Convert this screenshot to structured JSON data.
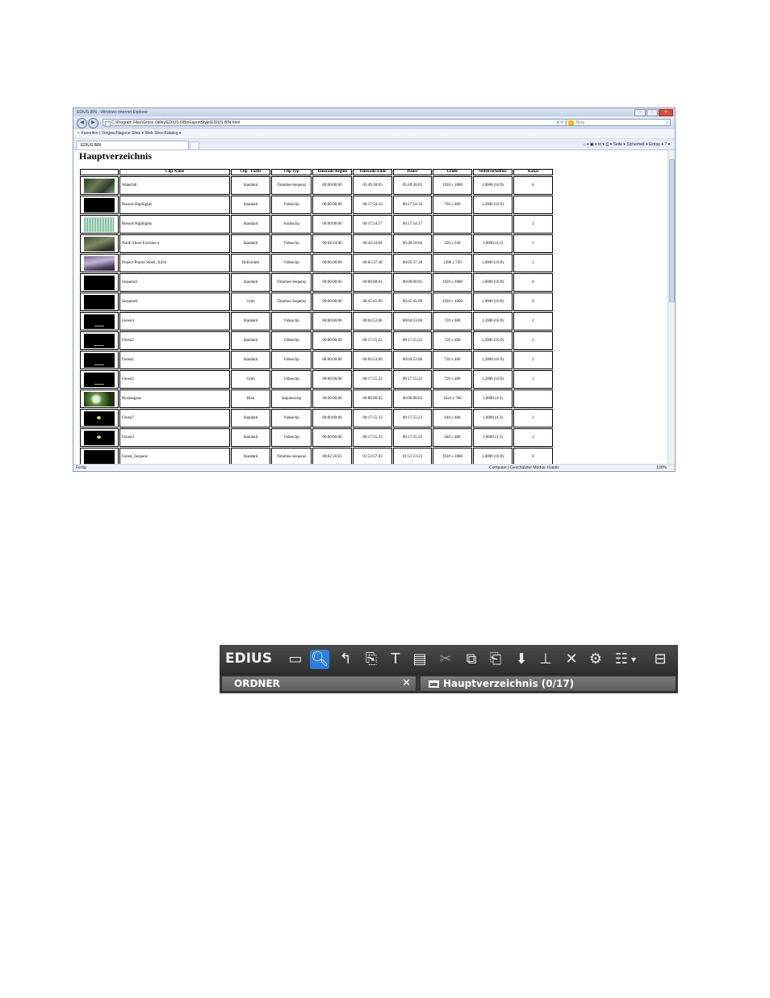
{
  "browser": {
    "window_title": "EDIUS BIN - Windows Internet Explorer",
    "address": "C:\\Program Files\\Grass Valley\\EDIUS 6\\BinExportStyle\\EDIUS BIN.html",
    "search_placeholder": "Bing",
    "favorites_bar": "Favoriten   |   Vorgeschlagene Sites ▾   Web Slice-Katalog ▾",
    "tab_label": "EDIUS BIN",
    "command_bar": "Seite ▾   Sicherheit ▾   Extras ▾",
    "status_left": "Fertig",
    "status_mid": "Computer | Geschützter Modus: Inaktiv",
    "status_zoom": "100%"
  },
  "page": {
    "heading": "Hauptverzeichnis",
    "columns": [
      "",
      "Clip-Name",
      "Clip - Farbe",
      "Clip-Typ",
      "Timecode-Beginn",
      "Timecode-Ende",
      "Dauer",
      "Größe",
      "Seitenverhältnis",
      "Kanal"
    ],
    "rows": [
      {
        "name": "Waterfall",
        "color": "Standard",
        "type": "Timeline-Sequenz",
        "tc_in": "00:00:00:00",
        "tc_out": "05:49:30:05",
        "duration": "05:49:30:05",
        "size": "1920 x 1080",
        "aspect": "1,0000 (16:9)",
        "channel": "8",
        "thumb": "t-waterfall"
      },
      {
        "name": "Rresort Highlights",
        "color": "Standard",
        "type": "Videoclip",
        "tc_in": "00:00:00:00",
        "tc_out": "00:17:54:16",
        "duration": "00:17:54:16",
        "size": "720 x 480",
        "aspect": "1,2000 (16:9)",
        "channel": "",
        "thumb": "t-black"
      },
      {
        "name": "Rresort Highlights",
        "color": "Standard",
        "type": "Audioclip",
        "tc_in": "00:00:00:00",
        "tc_out": "00:17:54:17",
        "duration": "00:17:54:17",
        "size": "",
        "aspect": "",
        "channel": "2",
        "thumb": "t-audio"
      },
      {
        "name": "North Shore Extreme 4",
        "color": "Standard",
        "type": "Videoclip",
        "tc_in": "00:04:24:00",
        "tc_out": "00:44:34:04",
        "duration": "00:40:10:04",
        "size": "320 x 240",
        "aspect": "1,0000 (4:3)",
        "channel": "1",
        "thumb": "t-north"
      },
      {
        "name": "Project Prairie Street_X264",
        "color": "Hellviolett",
        "type": "Videoclip",
        "tc_in": "00:00:00:00",
        "tc_out": "00:05:37:38",
        "duration": "00:05:37:38",
        "size": "1280 x 720",
        "aspect": "1,0000 (16:9)",
        "channel": "2",
        "thumb": "t-prairie"
      },
      {
        "name": "Sequenz2",
        "color": "Standard",
        "type": "Timeline-Sequenz",
        "tc_in": "00:00:00:00",
        "tc_out": "00:00:00:01",
        "duration": "00:00:00:01",
        "size": "1920 x 1080",
        "aspect": "1,0000 (16:9)",
        "channel": "8",
        "thumb": "t-black"
      },
      {
        "name": "Sequenz6",
        "color": "Grün",
        "type": "Timeline-Sequenz",
        "tc_in": "00:00:00:00",
        "tc_out": "00:45:45:09",
        "duration": "00:45:45:09",
        "size": "1920 x 1080",
        "aspect": "1,0000 (16:9)",
        "channel": "8",
        "thumb": "t-black"
      },
      {
        "name": "Forest4",
        "color": "Standard",
        "type": "Videoclip",
        "tc_in": "00:00:00:00",
        "tc_out": "00:04:53:06",
        "duration": "00:04:53:06",
        "size": "720 x 480",
        "aspect": "1,2000 (16:9)",
        "channel": "2",
        "thumb": "t-text"
      },
      {
        "name": "Forest5",
        "color": "Standard",
        "type": "Videoclip",
        "tc_in": "00:00:00;00",
        "tc_out": "00:17:55;22",
        "duration": "00:17:55;22",
        "size": "720 x 480",
        "aspect": "1,2000 (16:9)",
        "channel": "2",
        "thumb": "t-text"
      },
      {
        "name": "Forest1",
        "color": "Standard",
        "type": "Videoclip",
        "tc_in": "00:00:00:00",
        "tc_out": "00:04:53:06",
        "duration": "00:04:53:06",
        "size": "720 x 480",
        "aspect": "1,2000 (16:9)",
        "channel": "2",
        "thumb": "t-text"
      },
      {
        "name": "Forest2",
        "color": "Grün",
        "type": "Videoclip",
        "tc_in": "00:00:00;00",
        "tc_out": "00:17:55;22",
        "duration": "00:17:55;22",
        "size": "720 x 480",
        "aspect": "1,2000 (16:9)",
        "channel": "2",
        "thumb": "t-text"
      },
      {
        "name": "Hydrangeas",
        "color": "Blau",
        "type": "Sequenzclip",
        "tc_in": "00:00:00:00",
        "tc_out": "00:00:00:05",
        "duration": "00:00:00:05",
        "size": "1024 x 768",
        "aspect": "1,0000 (4:3)",
        "channel": "",
        "thumb": "t-hydra"
      },
      {
        "name": "Forest7",
        "color": "Standard",
        "type": "Videoclip",
        "tc_in": "00:00:00:00",
        "tc_out": "00:17:55:33",
        "duration": "00:17:55:23",
        "size": "640 x 480",
        "aspect": "1,0000 (4:3)",
        "channel": "2",
        "thumb": "t-flower"
      },
      {
        "name": "Forest3",
        "color": "Standard",
        "type": "Videoclip",
        "tc_in": "00:00:00:00",
        "tc_out": "00:17:55:33",
        "duration": "00:17:55:23",
        "size": "640 x 480",
        "aspect": "1,0000 (4:3)",
        "channel": "2",
        "thumb": "t-flower"
      },
      {
        "name": "Forest_Sequenz",
        "color": "Standard",
        "type": "Timeline-Sequenz",
        "tc_in": "00:02:30:03",
        "tc_out": "01:53:57:03",
        "duration": "01:51:13:23",
        "size": "1920 x 1080",
        "aspect": "1,0000 (16:9)",
        "channel": "8",
        "thumb": "t-black"
      }
    ]
  },
  "edius": {
    "logo": "EDIUS",
    "folder_label": "ORDNER",
    "close_symbol": "✕",
    "bin_title": "Hauptverzeichnis (0/17)",
    "accent_color": "#2f7fd6",
    "toolbar_icons": [
      "new-folder",
      "search",
      "up-level",
      "import",
      "title",
      "color-bar",
      "cut",
      "copy",
      "paste",
      "add-to-timeline",
      "insert",
      "delete",
      "properties",
      "view-menu",
      "open-bin"
    ]
  }
}
